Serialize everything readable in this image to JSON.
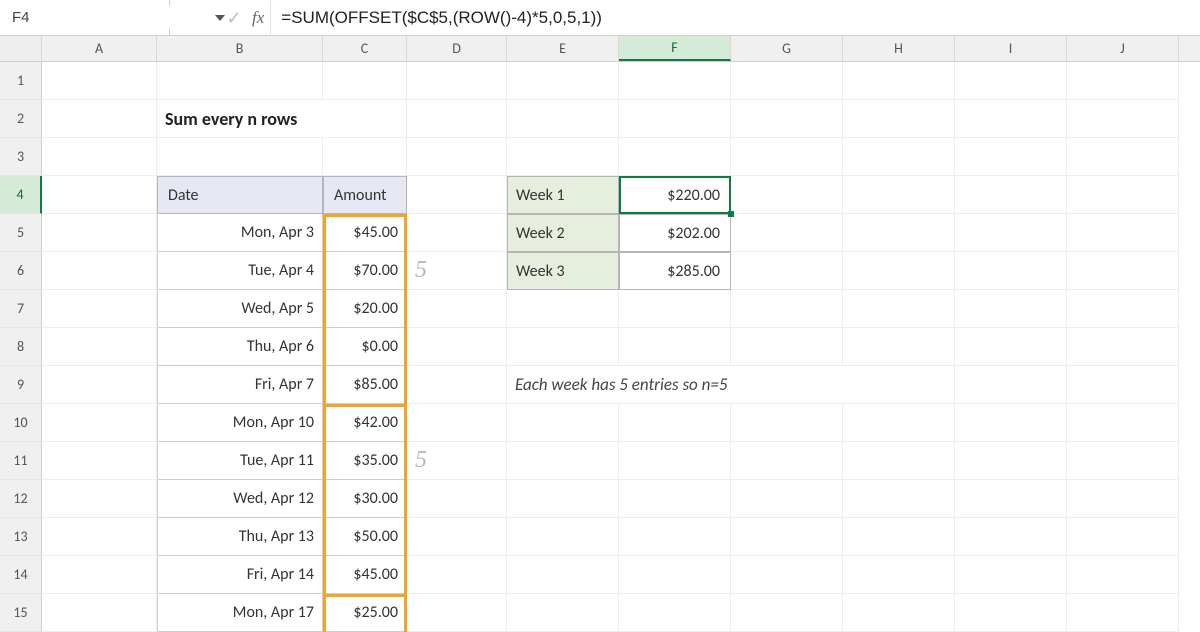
{
  "namebox": "F4",
  "formula": "=SUM(OFFSET($C$5,(ROW()-4)*5,0,5,1))",
  "fx_label": "fx",
  "col_headers": [
    "A",
    "B",
    "C",
    "D",
    "E",
    "F",
    "G",
    "H",
    "I",
    "J"
  ],
  "row_headers": [
    "1",
    "2",
    "3",
    "4",
    "5",
    "6",
    "7",
    "8",
    "9",
    "10",
    "11",
    "12",
    "13",
    "14",
    "15"
  ],
  "title": "Sum every n rows",
  "table": {
    "headers": {
      "date": "Date",
      "amount": "Amount"
    },
    "rows": [
      {
        "date": "Mon, Apr 3",
        "amount": "$45.00"
      },
      {
        "date": "Tue, Apr 4",
        "amount": "$70.00"
      },
      {
        "date": "Wed, Apr 5",
        "amount": "$20.00"
      },
      {
        "date": "Thu, Apr 6",
        "amount": "$0.00"
      },
      {
        "date": "Fri, Apr 7",
        "amount": "$85.00"
      },
      {
        "date": "Mon, Apr 10",
        "amount": "$42.00"
      },
      {
        "date": "Tue, Apr 11",
        "amount": "$35.00"
      },
      {
        "date": "Wed, Apr 12",
        "amount": "$30.00"
      },
      {
        "date": "Thu, Apr 13",
        "amount": "$50.00"
      },
      {
        "date": "Fri, Apr 14",
        "amount": "$45.00"
      },
      {
        "date": "Mon, Apr 17",
        "amount": "$25.00"
      }
    ]
  },
  "summary": [
    {
      "label": "Week 1",
      "value": "$220.00"
    },
    {
      "label": "Week 2",
      "value": "$202.00"
    },
    {
      "label": "Week 3",
      "value": "$285.00"
    }
  ],
  "annotations": {
    "five_a": "5",
    "five_b": "5"
  },
  "note": "Each week has 5 entries so n=5",
  "icons": {
    "cancel": "✕",
    "check": "✓"
  }
}
